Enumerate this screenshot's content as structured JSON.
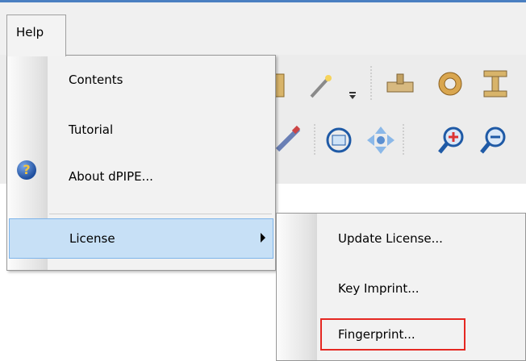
{
  "menubar": {
    "help_label": "Help"
  },
  "help_menu": {
    "items": [
      {
        "label": "Contents"
      },
      {
        "label": "Tutorial"
      },
      {
        "label": "About dPIPE..."
      },
      {
        "label": "License"
      }
    ]
  },
  "license_submenu": {
    "items": [
      {
        "label": "Update License..."
      },
      {
        "label": "Key Imprint..."
      },
      {
        "label": "Fingerprint..."
      }
    ]
  },
  "colors": {
    "selection": "#c7e0f6",
    "highlight_border": "#e52822",
    "accent_line": "#4a7fc1"
  }
}
